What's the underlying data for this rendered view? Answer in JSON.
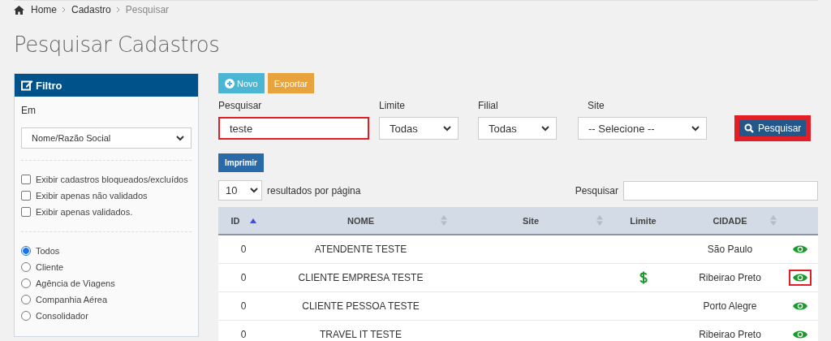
{
  "breadcrumb": [
    {
      "label": "Home",
      "kind": "home"
    },
    {
      "label": "Cadastro",
      "kind": "link"
    },
    {
      "label": "Pesquisar",
      "kind": "current"
    }
  ],
  "title": "Pesquisar Cadastros",
  "filter": {
    "title": "Filtro",
    "field_label": "Em",
    "field_value": "Nome/Razão Social",
    "checkboxes": [
      {
        "label": "Exibir cadastros bloqueados/excluídos",
        "checked": false
      },
      {
        "label": "Exibir apenas não validados",
        "checked": false
      },
      {
        "label": "Exibir apenas validados.",
        "checked": false
      }
    ],
    "radios": [
      {
        "label": "Todos",
        "selected": true
      },
      {
        "label": "Cliente",
        "selected": false
      },
      {
        "label": "Agência de Viagens",
        "selected": false
      },
      {
        "label": "Companhia Aérea",
        "selected": false
      },
      {
        "label": "Consolidador",
        "selected": false
      }
    ]
  },
  "toolbar": [
    {
      "label": "Novo",
      "kind": "new"
    },
    {
      "label": "Exportar",
      "kind": "export"
    }
  ],
  "search_form": {
    "fields": [
      {
        "label": "Pesquisar",
        "kind": "text",
        "value": "teste",
        "highlighted": true
      },
      {
        "label": "Limite",
        "kind": "select",
        "value": "Todas",
        "highlighted": false
      },
      {
        "label": "Filial",
        "kind": "select",
        "value": "Todas",
        "highlighted": false
      },
      {
        "label": "Site",
        "kind": "select",
        "value": "-- Selecione --",
        "highlighted": false
      }
    ],
    "button": {
      "label": "Pesquisar",
      "highlighted": true
    }
  },
  "print_button": "Imprimir",
  "page_size": {
    "value": "10",
    "label": "resultados por página"
  },
  "table_search": {
    "label": "Pesquisar"
  },
  "table": {
    "columns": [
      {
        "label": "ID",
        "sortable": true,
        "sorted": true
      },
      {
        "label": "NOME",
        "sortable": true,
        "sorted": false
      },
      {
        "label": "Site",
        "sortable": true,
        "sorted": false
      },
      {
        "label": "Limite",
        "sortable": false,
        "sorted": false
      },
      {
        "label": "CIDADE",
        "sortable": true,
        "sorted": false
      }
    ],
    "rows": [
      {
        "id": "0",
        "nome": "ATENDENTE TESTE",
        "limit_icon": false,
        "cidade": "São Paulo",
        "view_highlighted": false
      },
      {
        "id": "0",
        "nome": "CLIENTE EMPRESA TESTE",
        "limit_icon": true,
        "cidade": "Ribeirao Preto",
        "view_highlighted": true
      },
      {
        "id": "0",
        "nome": "CLIENTE PESSOA TESTE",
        "limit_icon": false,
        "cidade": "Porto Alegre",
        "view_highlighted": false
      },
      {
        "id": "0",
        "nome": "TRAVEL IT TESTE",
        "limit_icon": false,
        "cidade": "Ribeirao Preto",
        "view_highlighted": false
      }
    ]
  }
}
